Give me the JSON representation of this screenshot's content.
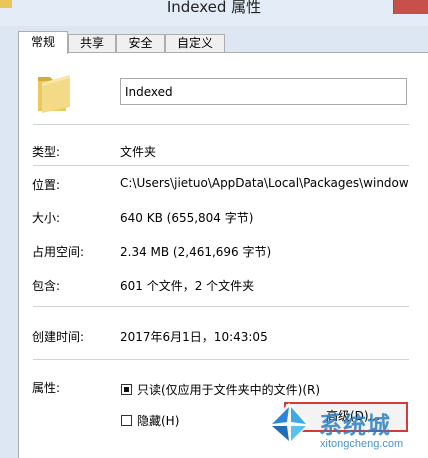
{
  "window": {
    "title": "Indexed 属性"
  },
  "tabs": [
    {
      "label": "常规",
      "active": true
    },
    {
      "label": "共享",
      "active": false
    },
    {
      "label": "安全",
      "active": false
    },
    {
      "label": "自定义",
      "active": false
    }
  ],
  "general": {
    "folder_icon": "folder-icon",
    "name_value": "Indexed",
    "rows": {
      "type": {
        "label": "类型:",
        "value": "文件夹"
      },
      "location": {
        "label": "位置:",
        "value": "C:\\Users\\jietuo\\AppData\\Local\\Packages\\window"
      },
      "size": {
        "label": "大小:",
        "value": "640 KB (655,804 字节)"
      },
      "disk_size": {
        "label": "占用空间:",
        "value": "2.34 MB (2,461,696 字节)"
      },
      "contains": {
        "label": "包含:",
        "value": "601 个文件，2 个文件夹"
      },
      "created": {
        "label": "创建时间:",
        "value": "2017年6月1日，10:43:05"
      }
    },
    "attributes": {
      "label": "属性:",
      "readonly": {
        "label": "只读(仅应用于文件夹中的文件)(R)",
        "checked": true
      },
      "hidden": {
        "label": "隐藏(H)",
        "checked": false
      },
      "advanced_button": "高级(D)..."
    }
  },
  "watermark": {
    "brand": "系统城",
    "url": "xitongcheng.com",
    "color": "#2b7fc3"
  },
  "colors": {
    "window_frame": "#dce7f3",
    "close_button": "#c7504b",
    "highlight_box": "#d33a3a"
  }
}
